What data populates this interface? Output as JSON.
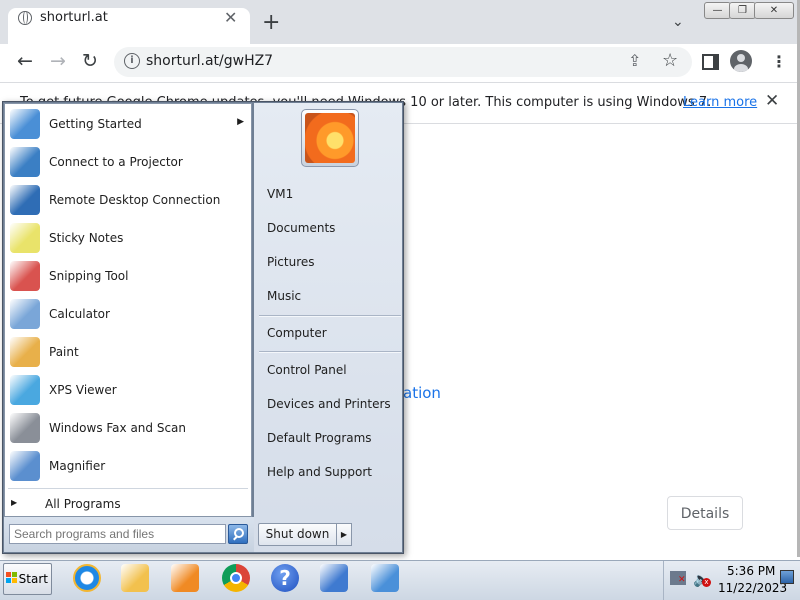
{
  "browser": {
    "tab_title": "shorturl.at",
    "tab_close_glyph": "✕",
    "new_tab_glyph": "+",
    "tab_search_glyph": "⌄",
    "back_glyph": "←",
    "forward_glyph": "→",
    "reload_glyph": "↻",
    "url": "shorturl.at/gwHZ7",
    "info_glyph": "i",
    "share_glyph": "⇪",
    "star_glyph": "☆",
    "menu_glyph": "⋮",
    "win_minimize": "—",
    "win_restore": "❐",
    "win_close": "✕"
  },
  "infobar": {
    "message": "To get future Google Chrome updates, you'll need Windows 10 or later. This computer is using Windows 7.",
    "learn_more": "Learn more",
    "close_glyph": "✕"
  },
  "page": {
    "link_text": "ation",
    "details_button": "Details"
  },
  "start_menu": {
    "programs": [
      {
        "label": "Getting Started",
        "icon": "getting-started-icon",
        "has_submenu": true,
        "submenu_glyph": "▶",
        "color": "#4a8fd6"
      },
      {
        "label": "Connect to a Projector",
        "icon": "projector-icon",
        "has_submenu": false,
        "color": "#3b7fc4"
      },
      {
        "label": "Remote Desktop Connection",
        "icon": "remote-desktop-icon",
        "has_submenu": false,
        "color": "#2f6db5"
      },
      {
        "label": "Sticky Notes",
        "icon": "sticky-notes-icon",
        "has_submenu": false,
        "color": "#e9e36a"
      },
      {
        "label": "Snipping Tool",
        "icon": "snipping-tool-icon",
        "has_submenu": false,
        "color": "#d9534f"
      },
      {
        "label": "Calculator",
        "icon": "calculator-icon",
        "has_submenu": false,
        "color": "#7aa6d8"
      },
      {
        "label": "Paint",
        "icon": "paint-icon",
        "has_submenu": false,
        "color": "#e8b04a"
      },
      {
        "label": "XPS Viewer",
        "icon": "xps-viewer-icon",
        "has_submenu": false,
        "color": "#4aa8e0"
      },
      {
        "label": "Windows Fax and Scan",
        "icon": "fax-scan-icon",
        "has_submenu": false,
        "color": "#8a8f98"
      },
      {
        "label": "Magnifier",
        "icon": "magnifier-icon",
        "has_submenu": false,
        "color": "#5b8fcf"
      }
    ],
    "all_programs": "All Programs",
    "all_programs_glyph": "▶",
    "search_placeholder": "Search programs and files",
    "shutdown": "Shut down",
    "shutdown_arrow": "▶",
    "places_group1": [
      "VM1",
      "Documents",
      "Pictures",
      "Music"
    ],
    "places_group2": [
      "Computer"
    ],
    "places_group3": [
      "Control Panel",
      "Devices and Printers",
      "Default Programs",
      "Help and Support"
    ]
  },
  "taskbar": {
    "start_label": "Start",
    "pinned": [
      {
        "name": "internet-explorer-icon",
        "color": "#1e88e5"
      },
      {
        "name": "file-explorer-icon",
        "color": "#f2c14e"
      },
      {
        "name": "media-player-icon",
        "color": "#f08a24"
      },
      {
        "name": "chrome-icon",
        "color": "#db4437"
      },
      {
        "name": "help-icon",
        "color": "#1e4fbf"
      },
      {
        "name": "action-center-app-icon",
        "color": "#3f7ad0"
      },
      {
        "name": "remote-app-icon",
        "color": "#4a90d9"
      }
    ],
    "help_glyph": "?",
    "volume_glyph": "🔈",
    "volume_x": "x",
    "time": "5:36 PM",
    "date": "11/22/2023"
  }
}
